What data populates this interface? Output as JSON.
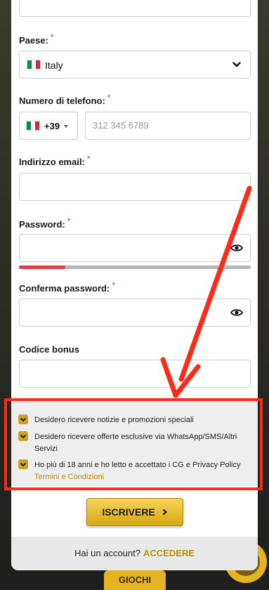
{
  "form": {
    "country": {
      "label": "Paese:",
      "required_mark": "*",
      "value": "Italy"
    },
    "phone": {
      "label": "Numero di telefono:",
      "required_mark": "*",
      "prefix": "+39",
      "placeholder": "312 345 6789"
    },
    "email": {
      "label": "Indirizzo email:",
      "required_mark": "*",
      "value": ""
    },
    "password": {
      "label": "Password:",
      "required_mark": "*",
      "strength": 0.2
    },
    "confirm_password": {
      "label": "Conferma password:",
      "required_mark": "*"
    },
    "bonus_code": {
      "label": "Codice bonus"
    }
  },
  "consents": [
    {
      "text": "Desidero ricevere notizie e promozioni speciali",
      "checked": true
    },
    {
      "text": "Desidero ricevere offerte esclusive via WhatsApp/SMS/Altri Servizi",
      "checked": true
    },
    {
      "text": "Ho più di 18 anni e ho letto e accettato i CG e Privacy Policy",
      "link": "Termini e Condizioni",
      "checked": true
    }
  ],
  "submit_label": "ISCRIVERE",
  "footer": {
    "prompt": "Hai un account?",
    "link": "ACCEDERE"
  },
  "background": {
    "bottom_button": "GIOCHI"
  },
  "colors": {
    "accent": "#c9a227",
    "annotation": "#ff2a18",
    "error": "#e53946"
  }
}
